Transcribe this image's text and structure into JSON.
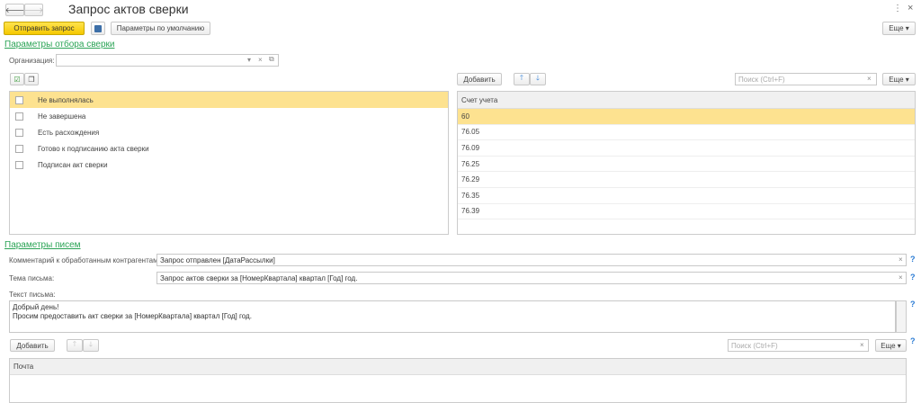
{
  "window": {
    "title": "Запрос актов сверки",
    "more_icon": "⋮",
    "close_icon": "×"
  },
  "toolbar": {
    "send_label": "Отправить запрос",
    "defaults_label": "Параметры по умолчанию",
    "more_label": "Еще ▾"
  },
  "filter": {
    "section_title": "Параметры отбора сверки",
    "org_label": "Организация:",
    "org_value": "",
    "statuses": [
      "Не выполнялась",
      "Не завершена",
      "Есть расхождения",
      "Готово к подписанию акта сверки",
      "Подписан акт сверки"
    ]
  },
  "accounts": {
    "add_label": "Добавить",
    "search_placeholder": "Поиск (Ctrl+F)",
    "more_label": "Еще ▾",
    "column": "Счет учета",
    "rows": [
      "60",
      "76.05",
      "76.09",
      "76.25",
      "76.29",
      "76.35",
      "76.39"
    ]
  },
  "letters": {
    "section_title": "Параметры писем",
    "comment_label": "Комментарий к обработанным контрагентам:",
    "comment_value": "Запрос отправлен [ДатаРассылки]",
    "subject_label": "Тема письма:",
    "subject_value": "Запрос актов сверки за [НомерКвартала] квартал [Год] год.",
    "body_label": "Текст письма:",
    "body_line1": "Добрый день!",
    "body_line2": "Просим предоставить акт сверки за [НомерКвартала] квартал [Год] год.",
    "add_label": "Добавить",
    "search_placeholder": "Поиск (Ctrl+F)",
    "more_label": "Еще ▾",
    "column": "Почта",
    "help": "?"
  }
}
